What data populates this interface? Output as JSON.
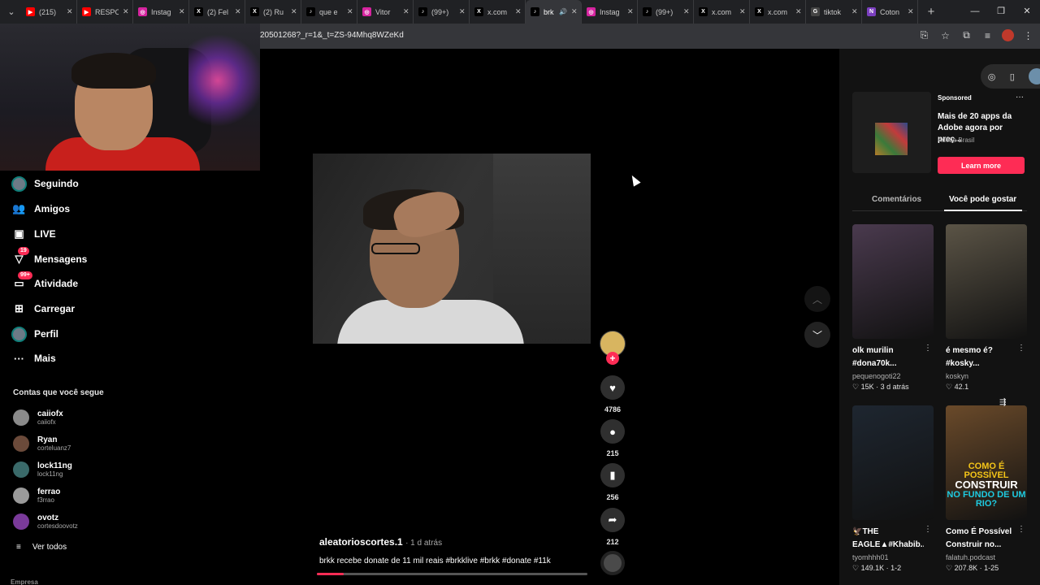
{
  "browser": {
    "tabs": [
      {
        "title": "(215)",
        "icon": "youtube-icon",
        "color": "#ff0000",
        "glyph": "▶"
      },
      {
        "title": "RESPO",
        "icon": "youtube-icon",
        "color": "#ff0000",
        "glyph": "▶"
      },
      {
        "title": "Instag",
        "icon": "instagram-icon",
        "color": "#d6249f",
        "glyph": "◎"
      },
      {
        "title": "(2) Fel",
        "icon": "x-icon",
        "color": "#000000",
        "glyph": "X"
      },
      {
        "title": "(2) Ru",
        "icon": "x-icon",
        "color": "#000000",
        "glyph": "X"
      },
      {
        "title": "que e",
        "icon": "tiktok-icon",
        "color": "#000000",
        "glyph": "♪"
      },
      {
        "title": "Vitor",
        "icon": "instagram-icon",
        "color": "#d6249f",
        "glyph": "◎"
      },
      {
        "title": "(99+)",
        "icon": "tiktok-icon",
        "color": "#000000",
        "glyph": "♪"
      },
      {
        "title": "x.com",
        "icon": "x-icon",
        "color": "#000000",
        "glyph": "X"
      },
      {
        "title": "brk",
        "icon": "tiktok-icon",
        "color": "#000000",
        "glyph": "♪",
        "active": true,
        "audio": true
      },
      {
        "title": "Instag",
        "icon": "instagram-icon",
        "color": "#d6249f",
        "glyph": "◎"
      },
      {
        "title": "(99+)",
        "icon": "tiktok-icon",
        "color": "#000000",
        "glyph": "♪"
      },
      {
        "title": "x.com",
        "icon": "x-icon",
        "color": "#000000",
        "glyph": "X"
      },
      {
        "title": "x.com",
        "icon": "x-icon",
        "color": "#000000",
        "glyph": "X"
      },
      {
        "title": "tiktok",
        "icon": "google-icon",
        "color": "#444444",
        "glyph": "G"
      },
      {
        "title": "Coton",
        "icon": "onenote-icon",
        "color": "#7b3fbf",
        "glyph": "N"
      }
    ],
    "url": "20501268?_r=1&_t=ZS-94Mhq8WZeKd"
  },
  "sidebar": {
    "nav": [
      {
        "label": "Seguindo",
        "icon": "following-avatar-icon"
      },
      {
        "label": "Amigos",
        "icon": "friends-icon",
        "glyph": "👥"
      },
      {
        "label": "LIVE",
        "icon": "live-icon",
        "glyph": "▣"
      },
      {
        "label": "Mensagens",
        "icon": "messages-icon",
        "glyph": "▽",
        "badge": "19"
      },
      {
        "label": "Atividade",
        "icon": "activity-icon",
        "glyph": "▭",
        "badge": "99+"
      },
      {
        "label": "Carregar",
        "icon": "upload-icon",
        "glyph": "⊞"
      },
      {
        "label": "Perfil",
        "icon": "profile-avatar-icon"
      },
      {
        "label": "Mais",
        "icon": "more-icon",
        "glyph": "···"
      }
    ],
    "following_title": "Contas que você segue",
    "accounts": [
      {
        "name": "caiiofx",
        "handle": "caiiofx",
        "color": "#8a8a8a"
      },
      {
        "name": "Ryan",
        "handle": "corteluanz7",
        "color": "#6b4a3a"
      },
      {
        "name": "lock11ng",
        "handle": "lock11ng",
        "color": "#3a6a6a"
      },
      {
        "name": "ferrao",
        "handle": "f3rrao",
        "color": "#9a9a9a"
      },
      {
        "name": "ovotz",
        "handle": "cortesdoovotz",
        "color": "#7a3a9a"
      }
    ],
    "see_all": "Ver todos",
    "company": "Empresa"
  },
  "video": {
    "author": "aleatorioscortes.1",
    "time": "1 d atrás",
    "caption": "brkk recebe donate de 11 mil reais #brkklive #brkk #donate #11k",
    "progress": 0.1,
    "likes": "4786",
    "comments": "215",
    "saves": "256",
    "shares": "212"
  },
  "right_panel": {
    "ad": {
      "sponsored": "Sponsored",
      "title": "Mais de 20 apps da Adobe agora por preç...",
      "brand": "Adobe Brasil",
      "cta": "Learn more"
    },
    "tabs": {
      "comments": "Comentários",
      "suggested": "Você pode gostar"
    },
    "cards": [
      {
        "title": "olk murilin #dona70k...",
        "author": "pequenogoti22",
        "stats": "♡ 15K · 3 d atrás",
        "bg": "#4a3a4e",
        "overlay": ""
      },
      {
        "title": "é mesmo é? #kosky...",
        "author": "koskyn",
        "stats": "♡ 42.1",
        "bg": "#5b5446",
        "overlay": ""
      },
      {
        "title": "🦅THE EAGLE▲#Khabib...",
        "author": "tyomhhh01",
        "stats": "♡ 149.1K · 1-2",
        "bg": "#1e2630",
        "overlay": ""
      },
      {
        "title": "Como É Possível Construir no...",
        "author": "falatuh.podcast",
        "stats": "♡ 207.8K · 1-25",
        "bg": "#6a4a2a",
        "overlay": "COMO É POSSÍVEL|CONSTRUIR|NO FUNDO DE UM RIO?"
      }
    ]
  }
}
